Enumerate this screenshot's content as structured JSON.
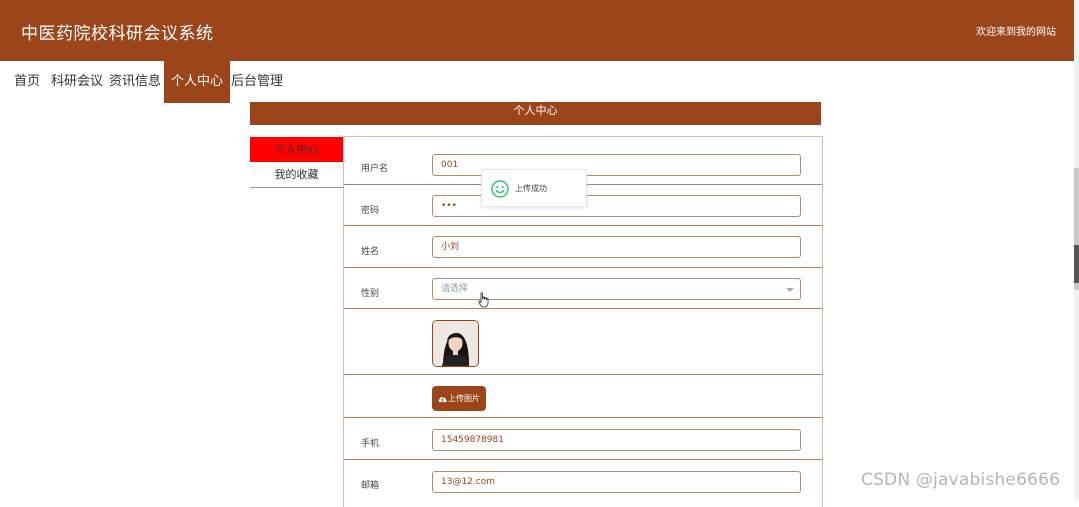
{
  "header": {
    "site_title": "中医药院校科研会议系统",
    "welcome_text": "欢迎来到我的网站"
  },
  "nav": {
    "items": [
      {
        "label": "首页"
      },
      {
        "label": "科研会议"
      },
      {
        "label": "资讯信息"
      },
      {
        "label": "个人中心",
        "active": true
      },
      {
        "label": "后台管理"
      }
    ]
  },
  "personal_center": {
    "title": "个人中心",
    "side_menu": [
      {
        "label": "个人中心",
        "active": true
      },
      {
        "label": "我的收藏"
      }
    ],
    "form": {
      "username": {
        "label": "用户名",
        "value": "001"
      },
      "password": {
        "label": "密码",
        "value": "•••"
      },
      "name": {
        "label": "姓名",
        "value": "小刘"
      },
      "gender": {
        "label": "性别",
        "placeholder": "请选择"
      },
      "upload_button": "上传图片",
      "phone": {
        "label": "手机",
        "value": "15459878981"
      },
      "email": {
        "label": "邮箱",
        "value": "13@12.com"
      }
    }
  },
  "toast": {
    "message": "上传成功",
    "icon": "smile-icon",
    "color": "#19be6b"
  },
  "watermark": "CSDN @javabishe6666",
  "colors": {
    "brand": "#9c451b",
    "active_side": "#ff0000"
  }
}
